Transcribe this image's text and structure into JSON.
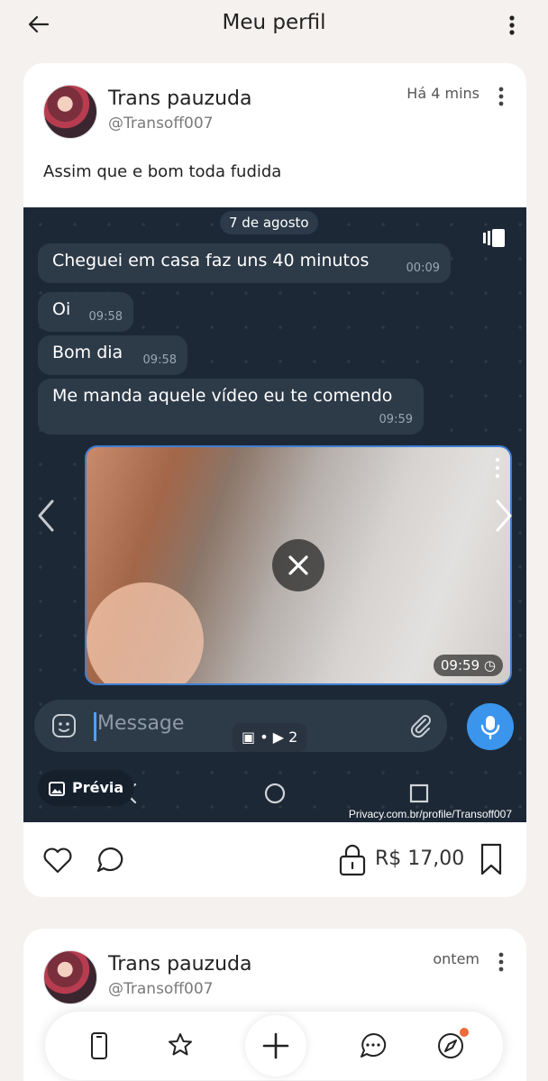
{
  "header": {
    "title": "Meu perfil"
  },
  "post": {
    "author_name": "Trans pauzuda",
    "author_handle": "@Transoff007",
    "time": "Há 4 mins",
    "caption": "Assim que e bom toda fudida",
    "media": {
      "date_chip": "7 de agosto",
      "messages": [
        {
          "text": "Cheguei em casa faz uns 40 minutos",
          "time": "00:09"
        },
        {
          "text": "Oi",
          "time": "09:58"
        },
        {
          "text": "Bom dia",
          "time": "09:58"
        },
        {
          "text": "Me manda aquele vídeo eu te comendo",
          "time": "09:59"
        }
      ],
      "video_time": "09:59",
      "input_placeholder": "Message",
      "counter": "2",
      "preview_label": "Prévia",
      "watermark": "Privacy.com.br/profile/Transoff007"
    },
    "price": "R$ 17,00"
  },
  "post2": {
    "author_name": "Trans pauzuda",
    "author_handle": "@Transoff007",
    "time": "ontem"
  },
  "colors": {
    "accent": "#3b95ec",
    "notification": "#f06a3a"
  }
}
